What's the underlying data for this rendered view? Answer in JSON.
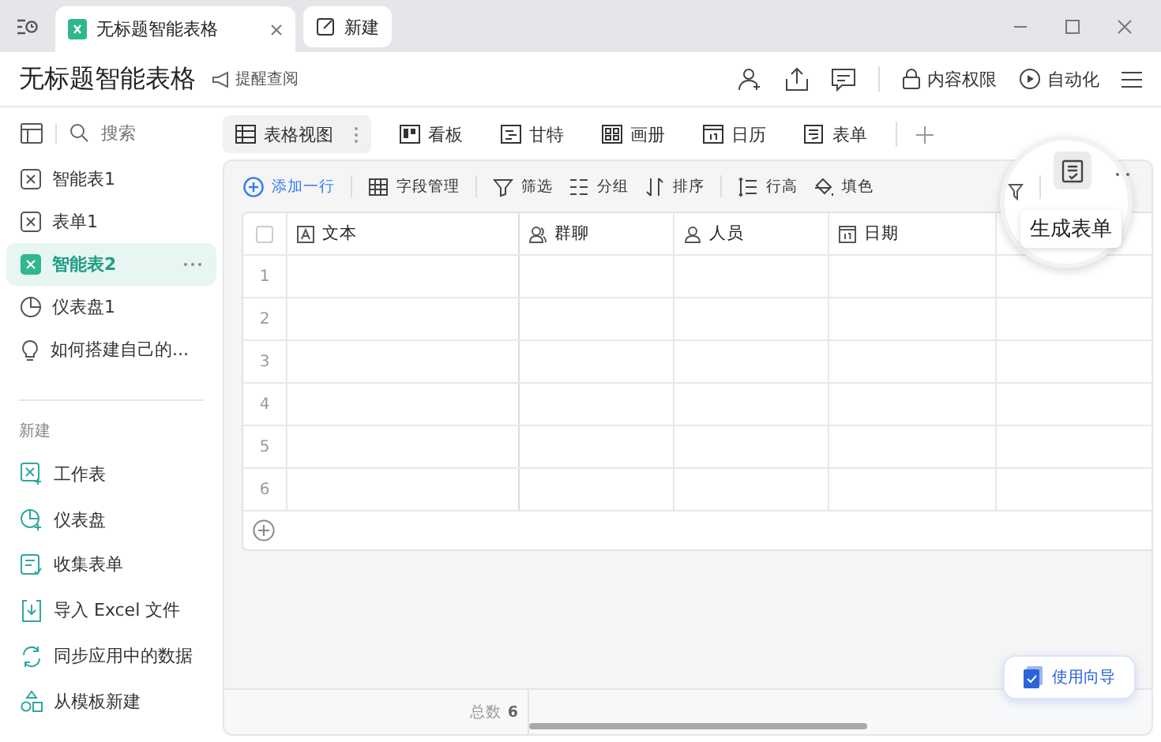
{
  "window": {
    "tabs": [
      {
        "label": "无标题智能表格",
        "selected": true
      },
      {
        "label": "新建",
        "selected": false
      }
    ]
  },
  "header": {
    "title": "无标题智能表格",
    "remind": "提醒查阅",
    "actions": [
      {
        "label": "内容权限",
        "kind": "lock"
      },
      {
        "label": "自动化",
        "kind": "play"
      }
    ]
  },
  "sidebar": {
    "search": {
      "placeholder": "搜索"
    },
    "items": [
      {
        "label": "智能表1",
        "kind": "sheet",
        "selected": false
      },
      {
        "label": "表单1",
        "kind": "sheet",
        "selected": false
      },
      {
        "label": "智能表2",
        "kind": "sheet",
        "selected": true
      },
      {
        "label": "仪表盘1",
        "kind": "pie",
        "selected": false
      },
      {
        "label": "如何搭建自己的...",
        "kind": "bulb",
        "selected": false
      }
    ],
    "new_heading": "新建",
    "new_items": [
      {
        "label": "工作表",
        "kind": "sheet"
      },
      {
        "label": "仪表盘",
        "kind": "pie"
      },
      {
        "label": "收集表单",
        "kind": "form"
      },
      {
        "label": "导入 Excel 文件",
        "kind": "import"
      },
      {
        "label": "同步应用中的数据",
        "kind": "sync"
      },
      {
        "label": "从模板新建",
        "kind": "shapes"
      }
    ]
  },
  "views": [
    {
      "label": "表格视图",
      "kind": "grid",
      "selected": true
    },
    {
      "label": "看板",
      "kind": "board",
      "selected": false
    },
    {
      "label": "甘特",
      "kind": "gantt",
      "selected": false
    },
    {
      "label": "画册",
      "kind": "album",
      "selected": false
    },
    {
      "label": "日历",
      "kind": "cal",
      "selected": false
    },
    {
      "label": "表单",
      "kind": "form",
      "selected": false
    }
  ],
  "toolbar": [
    {
      "label": "添加一行",
      "kind": "add"
    },
    {
      "label": "字段管理",
      "kind": "grid"
    },
    {
      "label": "筛选",
      "kind": "filter"
    },
    {
      "label": "分组",
      "kind": "group"
    },
    {
      "label": "排序",
      "kind": "sort"
    },
    {
      "label": "行高",
      "kind": "height"
    },
    {
      "label": "填色",
      "kind": "fill"
    }
  ],
  "table": {
    "columns": [
      {
        "label": "文本",
        "kind": "text"
      },
      {
        "label": "群聊",
        "kind": "group"
      },
      {
        "label": "人员",
        "kind": "person"
      },
      {
        "label": "日期",
        "kind": "cal"
      }
    ],
    "select_all_checked": false,
    "rows": [
      "1",
      "2",
      "3",
      "4",
      "5",
      "6"
    ],
    "total_label": "总数",
    "total": "6"
  },
  "tooltip": "生成表单",
  "guide_button": "使用向导"
}
